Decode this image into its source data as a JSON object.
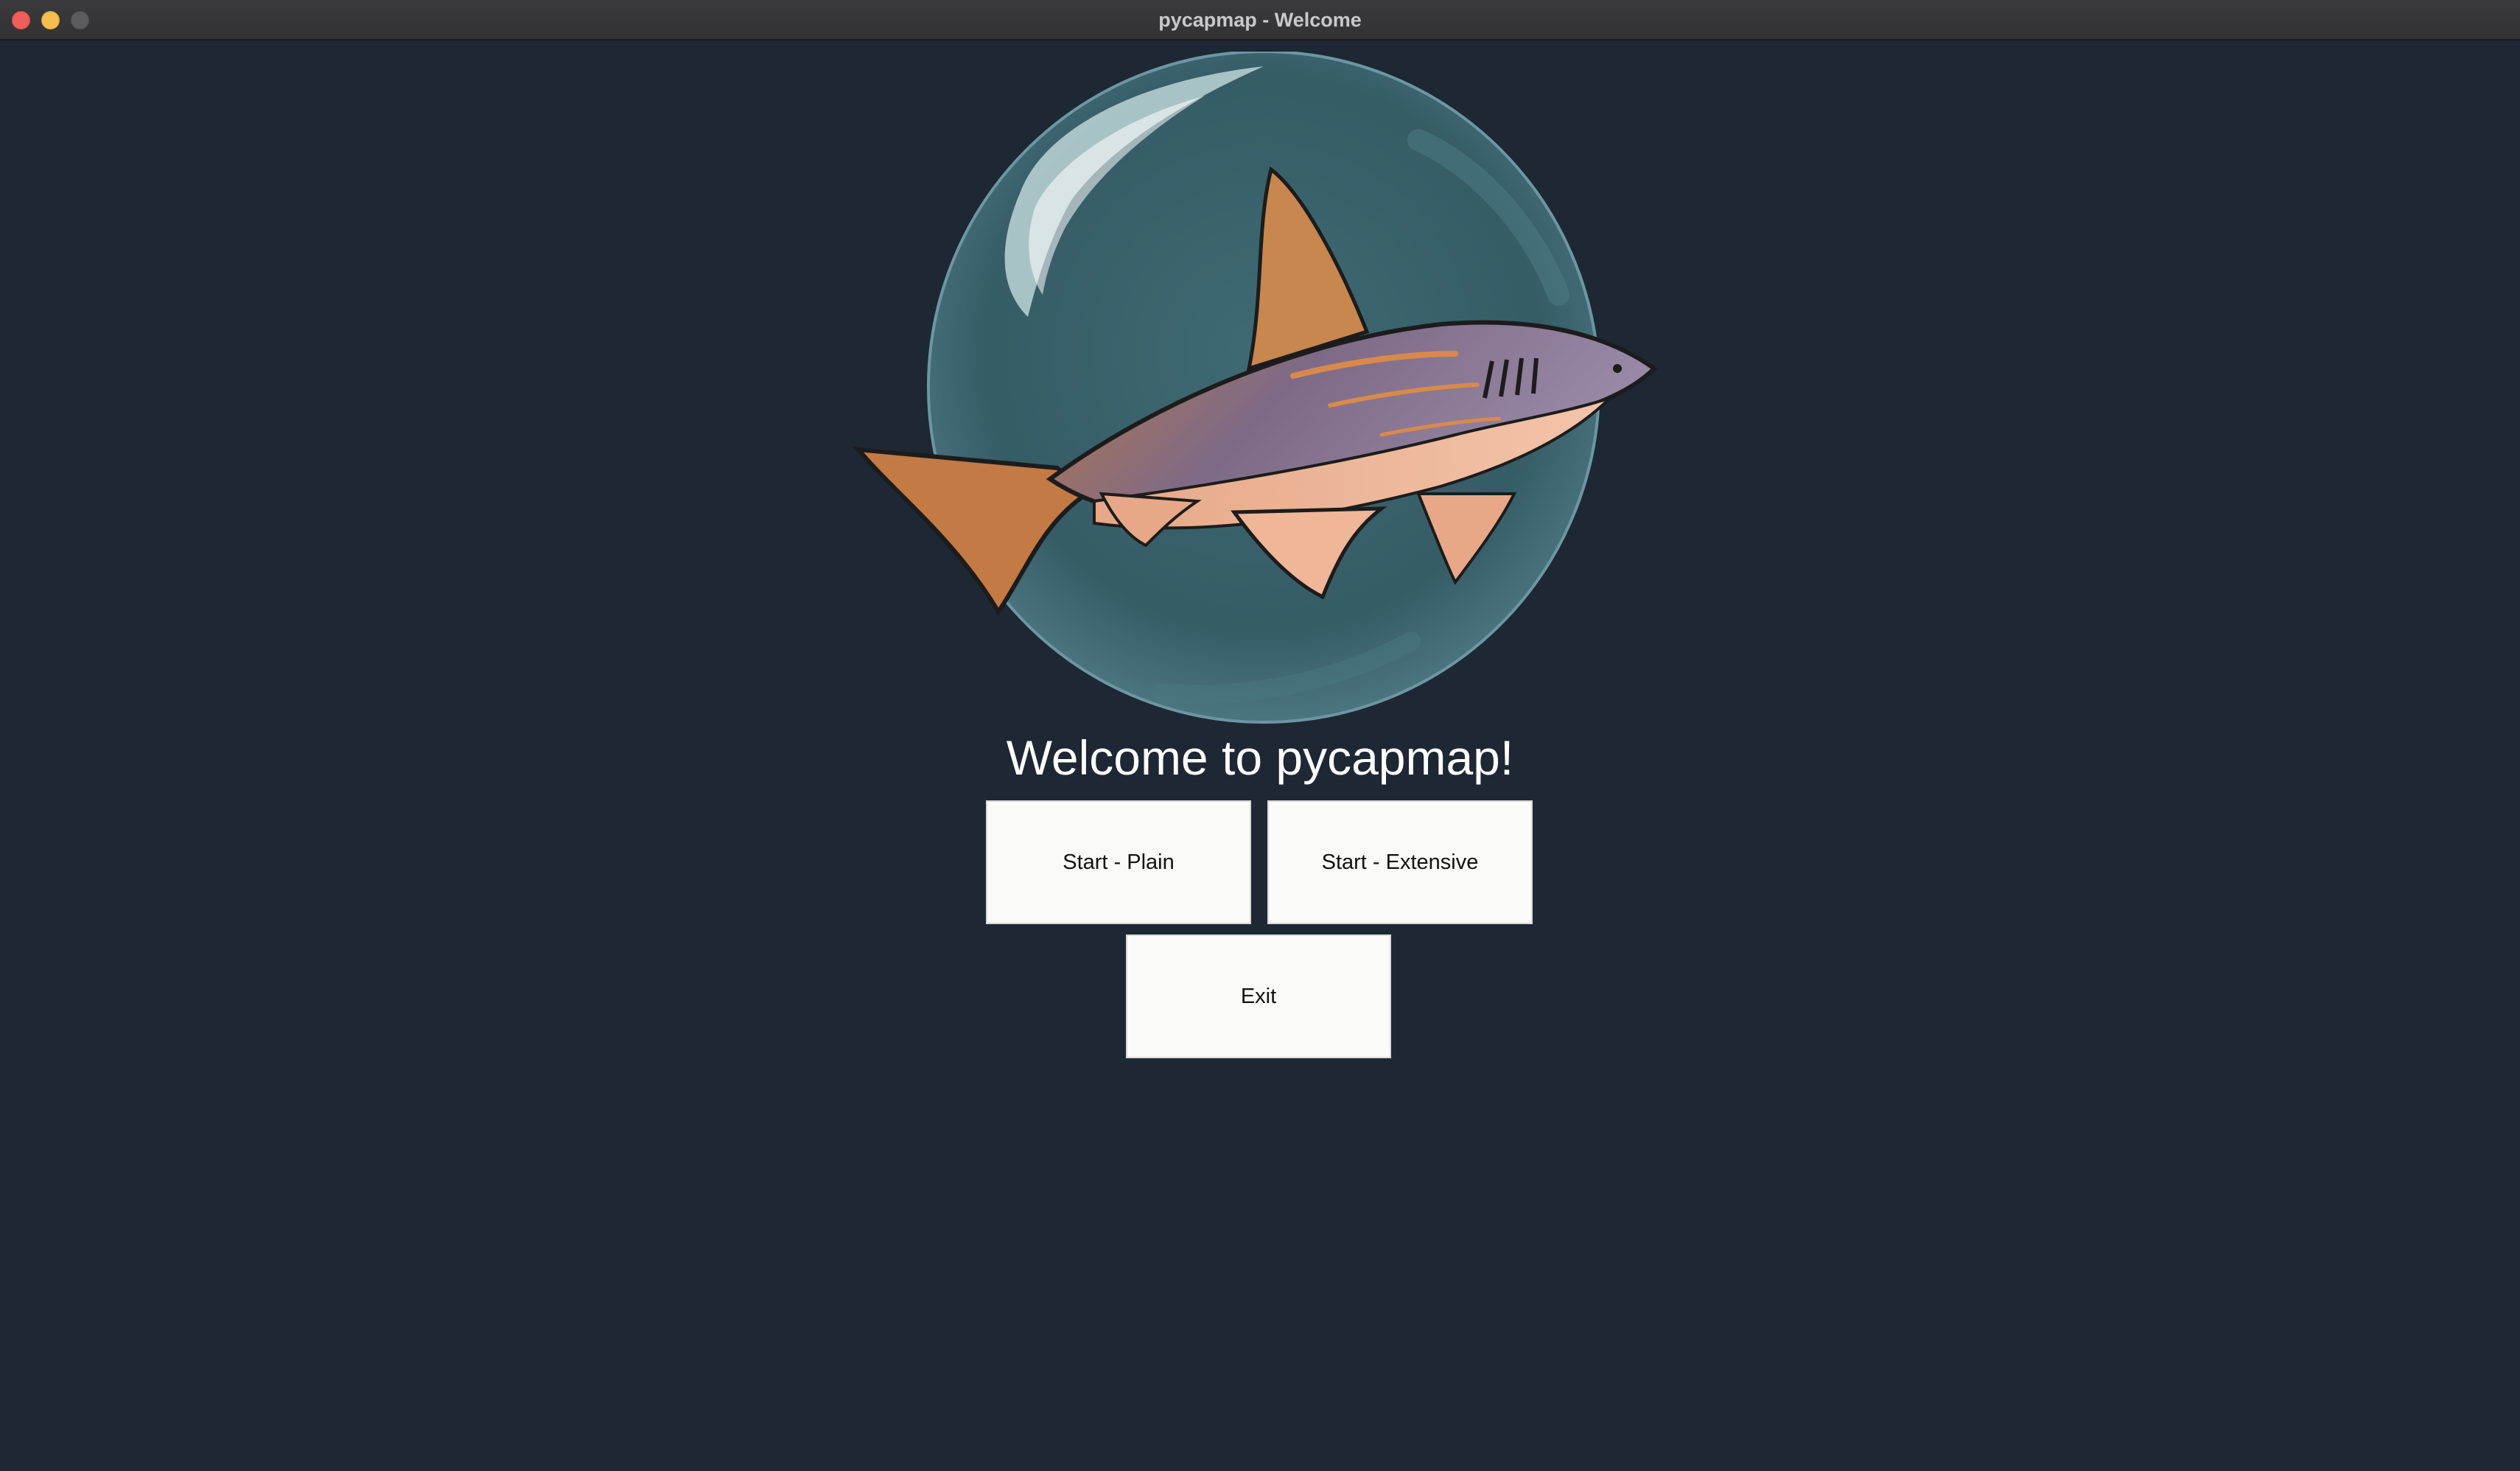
{
  "window": {
    "title": "pycapmap - Welcome"
  },
  "main": {
    "logo": "shark-logo",
    "welcome_text": "Welcome to pycapmap!",
    "buttons": {
      "start_plain": "Start - Plain",
      "start_extensive": "Start - Extensive",
      "exit": "Exit"
    }
  },
  "colors": {
    "background": "#1e2734",
    "button_bg": "#fafaf8",
    "close": "#ee5f57",
    "minimize": "#f5be4f"
  }
}
